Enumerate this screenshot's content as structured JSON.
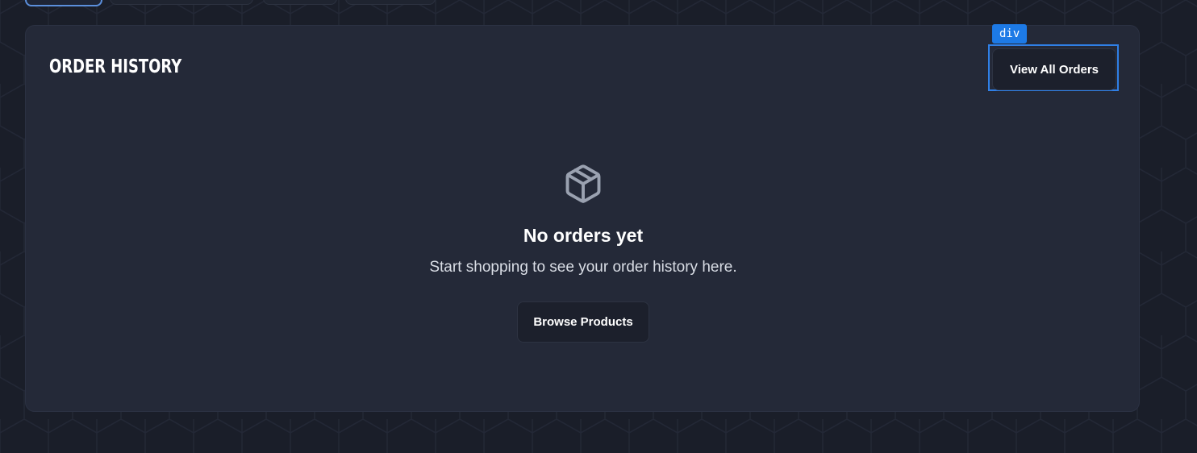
{
  "card": {
    "title": "ORDER HISTORY",
    "view_all_label": "View All Orders"
  },
  "inspector": {
    "tag": "div"
  },
  "empty_state": {
    "icon": "package-icon",
    "title": "No orders yet",
    "subtitle": "Start shopping to see your order history here.",
    "browse_label": "Browse Products"
  },
  "colors": {
    "background": "#1a1e29",
    "card": "#242938",
    "inspector_blue": "#1d7ae6",
    "active_tab_border": "#5b8fdc",
    "icon_gray": "#9aa1b0"
  }
}
